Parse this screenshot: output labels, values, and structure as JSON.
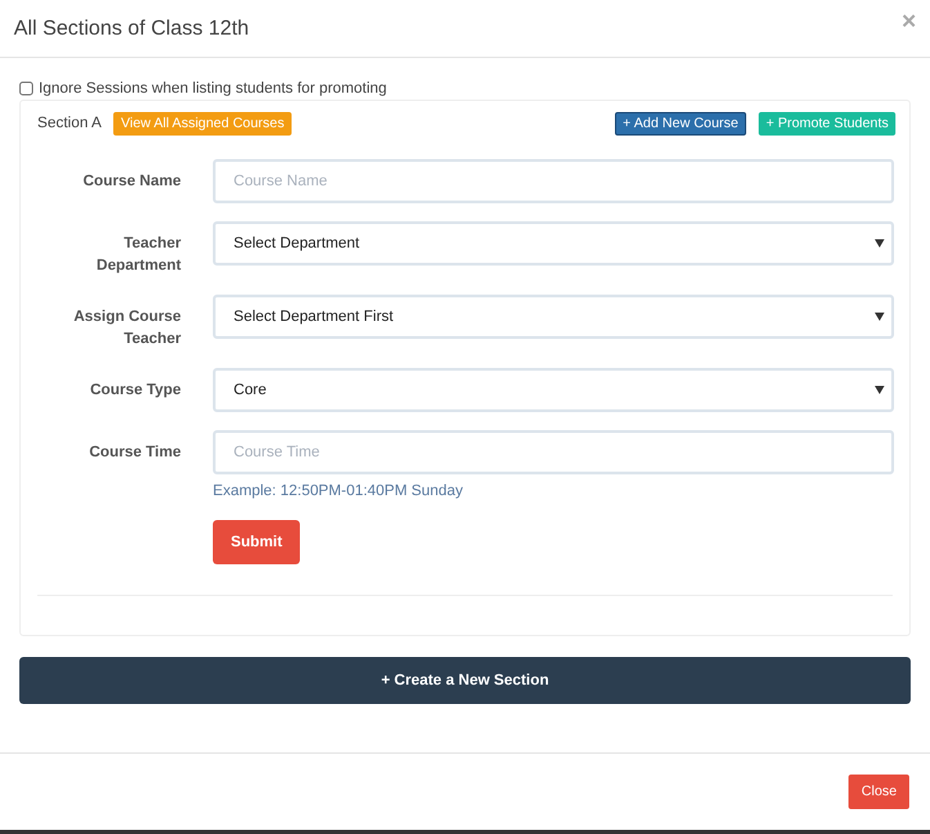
{
  "modal": {
    "title": "All Sections of Class 12th",
    "close_icon": "×"
  },
  "ignore_sessions": {
    "label": "Ignore Sessions when listing students for promoting",
    "checked": false
  },
  "section": {
    "name": "Section A",
    "view_button": "View All Assigned Courses",
    "actions": [
      "+ Add New Course",
      "+ Promote Students"
    ]
  },
  "form": {
    "fields": [
      {
        "label": "Course Name",
        "kind": "input",
        "placeholder": "Course Name"
      },
      {
        "label": "Teacher Department",
        "kind": "select",
        "value": "Select Department"
      },
      {
        "label": "Assign Course Teacher",
        "kind": "select",
        "value": "Select Department First"
      },
      {
        "label": "Course Type",
        "kind": "select",
        "value": "Core"
      },
      {
        "label": "Course Time",
        "kind": "input",
        "placeholder": "Course Time",
        "help": "Example: 12:50PM-01:40PM Sunday"
      }
    ],
    "submit": "Submit"
  },
  "create_button": "+ Create a New Section",
  "footer": {
    "close_button": "Close"
  }
}
